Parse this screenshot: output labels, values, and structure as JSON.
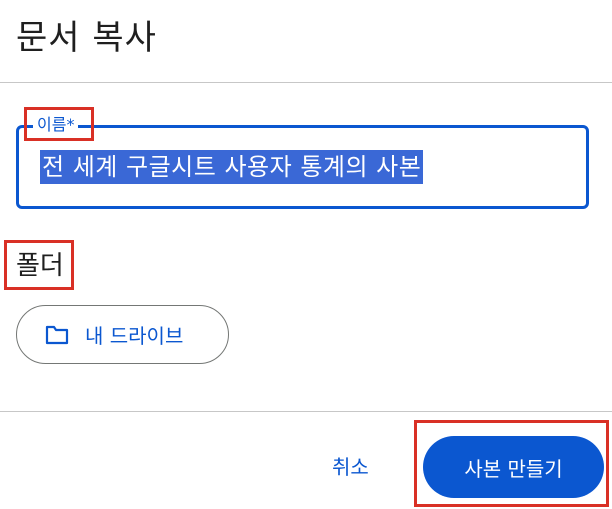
{
  "dialog": {
    "title": "문서 복사"
  },
  "name_field": {
    "label": "이름*",
    "value": "전 세계 구글시트 사용자 통계의 사본"
  },
  "folder": {
    "heading": "폴더",
    "chip_label": "내 드라이브",
    "chip_icon": "folder-icon"
  },
  "actions": {
    "cancel_label": "취소",
    "create_label": "사본 만들기"
  },
  "colors": {
    "accent": "#0b57d0",
    "highlight": "#d93025",
    "selection": "#3a68d6"
  }
}
